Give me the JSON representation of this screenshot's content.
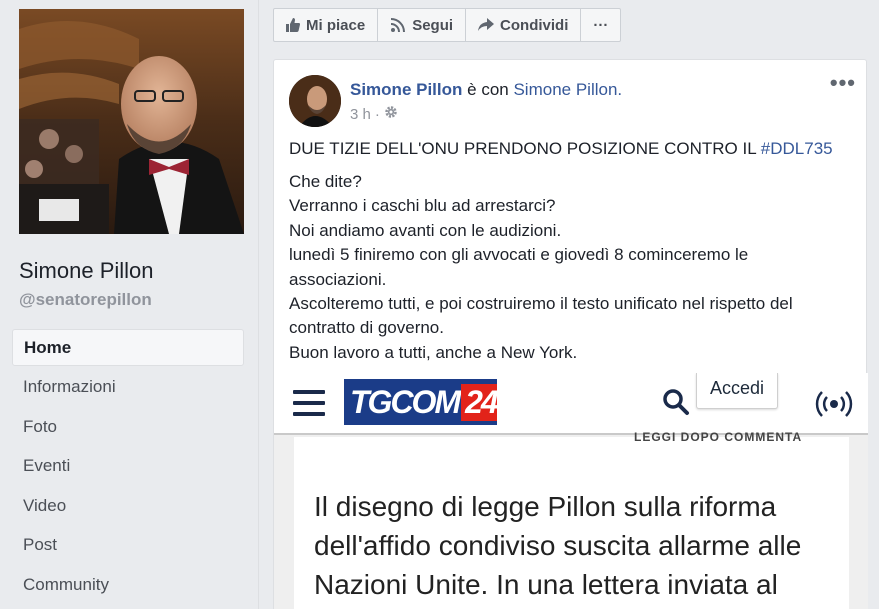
{
  "sidebar": {
    "page_name": "Simone Pillon",
    "handle": "@senatorepillon",
    "items": [
      {
        "label": "Home",
        "active": true
      },
      {
        "label": "Informazioni"
      },
      {
        "label": "Foto"
      },
      {
        "label": "Eventi"
      },
      {
        "label": "Video"
      },
      {
        "label": "Post"
      },
      {
        "label": "Community"
      }
    ]
  },
  "action_bar": {
    "like": "Mi piace",
    "follow": "Segui",
    "share": "Condividi",
    "more": "···"
  },
  "post": {
    "author": "Simone Pillon",
    "with_text": "è con",
    "tagged": "Simone Pillon.",
    "time": "3 h",
    "dot": "·",
    "title_prefix": "DUE TIZIE DELL'ONU PRENDONO POSIZIONE CONTRO IL",
    "hashtag": "#DDL735",
    "body_lines": [
      "Che dite?",
      "Verranno i caschi blu ad arrestarci?",
      "Noi andiamo avanti con le audizioni.",
      "lunedì 5 finiremo con gli avvocati e giovedì 8 cominceremo le",
      "associazioni.",
      "Ascolteremo tutti, e poi costruiremo il testo unificato nel rispetto del",
      "contratto di governo.",
      "Buon lavoro a tutti, anche a New York."
    ]
  },
  "embed": {
    "logo_text": "TGCOM",
    "logo_num": "24",
    "login": "Accedi",
    "cut_text": "LEGGI DOPO   COMMENTA",
    "article_lines": [
      "Il disegno di legge Pillon sulla riforma",
      "dell'affido condiviso suscita allarme alle",
      "Nazioni Unite. In una lettera inviata al"
    ]
  },
  "icons": {
    "like": "thumbs-up-icon",
    "follow": "rss-icon",
    "share": "share-arrow-icon",
    "gear": "gear-icon",
    "search": "search-icon",
    "live": "broadcast-icon",
    "menu": "hamburger-menu-icon"
  },
  "colors": {
    "link": "#365899",
    "bg": "#e9ebee",
    "tgcom_blue": "#1b3c88",
    "tgcom_red": "#e2231a"
  }
}
